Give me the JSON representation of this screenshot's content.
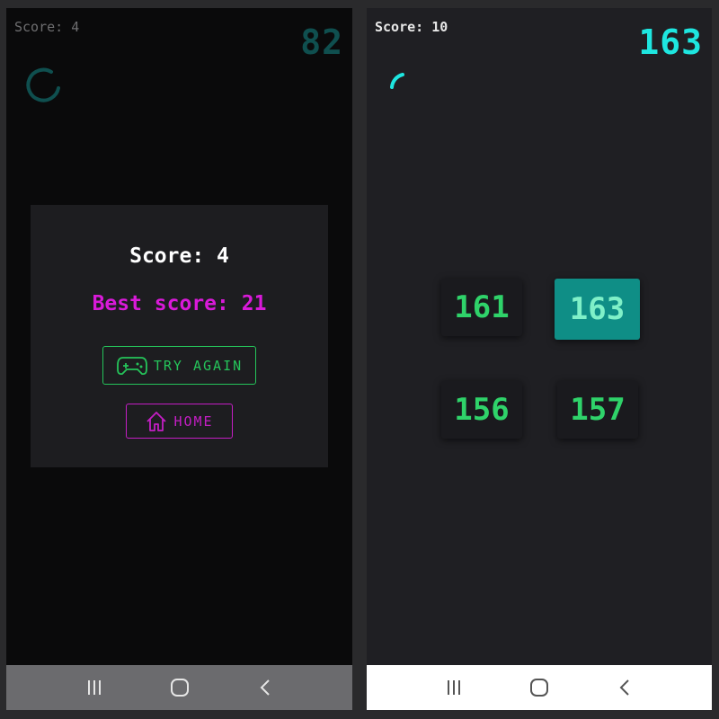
{
  "left_screen": {
    "score_label": "Score: 4",
    "target_number": "82",
    "dialog": {
      "score_text": "Score: 4",
      "best_score_text": "Best score: 21",
      "try_again_label": "TRY AGAIN",
      "home_label": "HOME"
    },
    "timer_progress": 0.7,
    "navbar_icons": [
      "recent-apps-icon",
      "home-icon",
      "back-icon"
    ]
  },
  "right_screen": {
    "score_label": "Score: 10",
    "target_number": "163",
    "timer_progress": 0.15,
    "choices": [
      {
        "value": "161",
        "selected": false
      },
      {
        "value": "163",
        "selected": true
      },
      {
        "value": "156",
        "selected": false
      },
      {
        "value": "157",
        "selected": false
      }
    ],
    "navbar_icons": [
      "recent-apps-icon",
      "home-icon",
      "back-icon"
    ]
  },
  "colors": {
    "green_accent": "#25c45a",
    "magenta_accent": "#c41ec4",
    "cyan_accent": "#1ee6e0",
    "dark_teal": "#0f4f4f",
    "selected_tile": "#0f8e86"
  }
}
